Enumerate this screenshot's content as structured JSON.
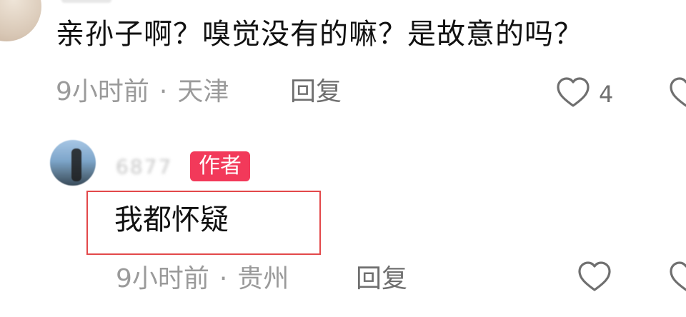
{
  "top_comment": {
    "text": "亲孙子啊？嗅觉没有的嘛？是故意的吗？",
    "time": "9小时前",
    "separator": "·",
    "location": "天津",
    "reply_label": "回复",
    "like_count": "4",
    "like_icon": "heart-outline-icon"
  },
  "reply_comment": {
    "username": "6877",
    "author_badge": "作者",
    "text": "我都怀疑",
    "time": "9小时前",
    "separator": "·",
    "location": "贵州",
    "reply_label": "回复",
    "like_icon": "heart-outline-icon"
  },
  "colors": {
    "badge": "#f2395a",
    "highlight_box": "#e3484a",
    "meta_text": "#9a9a9a"
  }
}
